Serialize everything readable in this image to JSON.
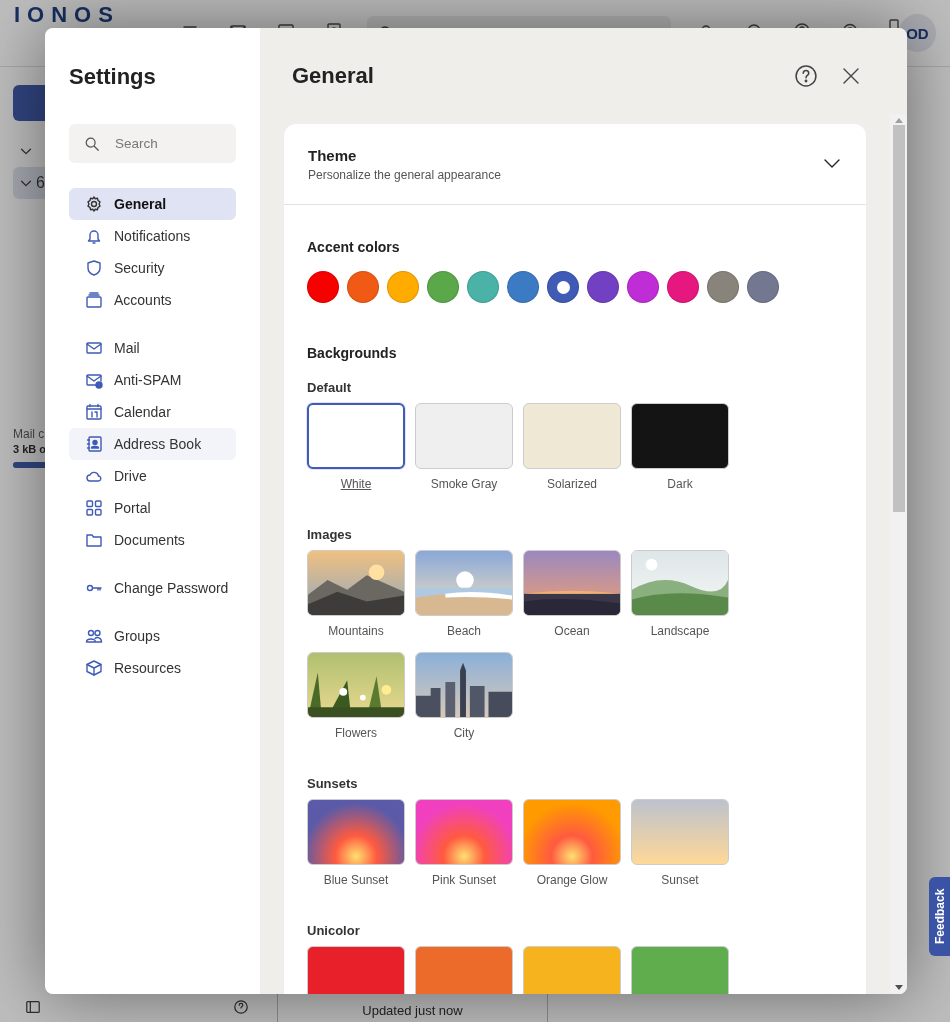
{
  "app": {
    "logo": "IONOS",
    "avatar": "OD",
    "folder_count": "6",
    "quota": {
      "label": "Mail c",
      "value": "3 kB o",
      "level": 0.2
    },
    "status": "Updated just now"
  },
  "dialog": {
    "title": "Settings",
    "search": {
      "placeholder": "Search"
    },
    "sidebar": {
      "sections": [
        {
          "items": [
            {
              "label": "General",
              "selected": true,
              "hovered": false
            },
            {
              "label": "Notifications",
              "selected": false,
              "hovered": false
            },
            {
              "label": "Security",
              "selected": false,
              "hovered": false
            },
            {
              "label": "Accounts",
              "selected": false,
              "hovered": false
            }
          ]
        },
        {
          "items": [
            {
              "label": "Mail",
              "selected": false,
              "hovered": false
            },
            {
              "label": "Anti-SPAM",
              "selected": false,
              "hovered": false
            },
            {
              "label": "Calendar",
              "selected": false,
              "hovered": false
            },
            {
              "label": "Address Book",
              "selected": false,
              "hovered": true
            },
            {
              "label": "Drive",
              "selected": false,
              "hovered": false
            },
            {
              "label": "Portal",
              "selected": false,
              "hovered": false
            },
            {
              "label": "Documents",
              "selected": false,
              "hovered": false
            }
          ]
        },
        {
          "items": [
            {
              "label": "Change Password",
              "selected": false,
              "hovered": false
            }
          ]
        },
        {
          "items": [
            {
              "label": "Groups",
              "selected": false,
              "hovered": false
            },
            {
              "label": "Resources",
              "selected": false,
              "hovered": false
            }
          ]
        }
      ]
    },
    "page_title": "General",
    "theme": {
      "title": "Theme",
      "subtitle": "Personalize the general appearance",
      "expanded": true,
      "accent_heading": "Accent colors",
      "accent_colors": [
        {
          "color": "#f70000",
          "selected": false
        },
        {
          "color": "#f05a14",
          "selected": false
        },
        {
          "color": "#ffab00",
          "selected": false
        },
        {
          "color": "#5aa84a",
          "selected": false
        },
        {
          "color": "#4ab2a7",
          "selected": false
        },
        {
          "color": "#3d7ac4",
          "selected": false
        },
        {
          "color": "#3f5bb5",
          "selected": true
        },
        {
          "color": "#7240c2",
          "selected": false
        },
        {
          "color": "#bf2dd6",
          "selected": false
        },
        {
          "color": "#e6177e",
          "selected": false
        },
        {
          "color": "#88847b",
          "selected": false
        },
        {
          "color": "#747790",
          "selected": false
        }
      ],
      "backgrounds_heading": "Backgrounds",
      "groups": [
        {
          "title": "Default",
          "items": [
            {
              "label": "White",
              "kind": "color",
              "color": "#ffffff",
              "selected": true
            },
            {
              "label": "Smoke Gray",
              "kind": "color",
              "color": "#efefef",
              "selected": false
            },
            {
              "label": "Solarized",
              "kind": "color",
              "color": "#eee8d5",
              "selected": false
            },
            {
              "label": "Dark",
              "kind": "color",
              "color": "#141414",
              "selected": false
            }
          ]
        },
        {
          "title": "Images",
          "items": [
            {
              "label": "Mountains",
              "kind": "picture",
              "selected": false
            },
            {
              "label": "Beach",
              "kind": "picture",
              "selected": false
            },
            {
              "label": "Ocean",
              "kind": "picture",
              "selected": false
            },
            {
              "label": "Landscape",
              "kind": "picture",
              "selected": false
            },
            {
              "label": "Flowers",
              "kind": "picture",
              "selected": false
            },
            {
              "label": "City",
              "kind": "picture",
              "selected": false
            }
          ]
        },
        {
          "title": "Sunsets",
          "items": [
            {
              "label": "Blue Sunset",
              "kind": "radial",
              "color": "#5a5aa8",
              "selected": false
            },
            {
              "label": "Pink Sunset",
              "kind": "radial",
              "color": "#f040c0",
              "selected": false
            },
            {
              "label": "Orange Glow",
              "kind": "radial",
              "color": "#ff9a00",
              "selected": false
            },
            {
              "label": "Sunset",
              "kind": "linear",
              "color": "#bcc2cc",
              "selected": false
            }
          ]
        },
        {
          "title": "Unicolor",
          "items": [
            {
              "kind": "color",
              "color": "#e8202a",
              "selected": false
            },
            {
              "kind": "color",
              "color": "#ec6a2a",
              "selected": false
            },
            {
              "kind": "color",
              "color": "#f6b31e",
              "selected": false
            },
            {
              "kind": "color",
              "color": "#60ad4e",
              "selected": false
            }
          ]
        }
      ]
    }
  },
  "feedback": "Feedback"
}
